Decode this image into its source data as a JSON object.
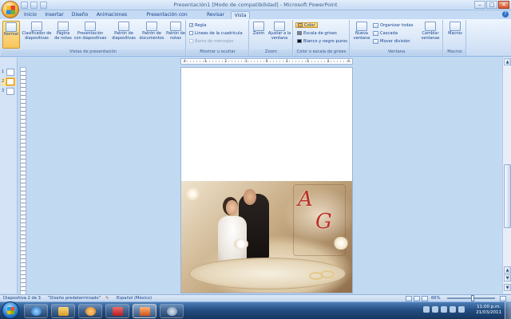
{
  "window": {
    "title": "Presentación1 [Modo de compatibilidad] - Microsoft PowerPoint",
    "controls": {
      "minimize": "–",
      "maximize": "□",
      "close": "✕"
    }
  },
  "ribbon_tabs": [
    "Inicio",
    "Insertar",
    "Diseño",
    "Animaciones",
    "Presentación con diapositivas",
    "Revisar",
    "Vista"
  ],
  "active_tab": "Vista",
  "groups": {
    "vistas": {
      "label": "Vistas de presentación",
      "buttons": [
        "Normal",
        "Clasificador de diapositivas",
        "Página de notas",
        "Presentación con diapositivas",
        "Patrón de diapositivas",
        "Patrón de documentos",
        "Patrón de notas"
      ]
    },
    "mostrar": {
      "label": "Mostrar u ocultar",
      "items": [
        {
          "label": "Regla",
          "checked": true
        },
        {
          "label": "Líneas de la cuadrícula",
          "checked": false
        },
        {
          "label": "Barra de mensajes",
          "checked": false,
          "disabled": true
        }
      ]
    },
    "zoom": {
      "label": "Zoom",
      "buttons": [
        "Zoom",
        "Ajustar a la ventana"
      ]
    },
    "color": {
      "label": "Color o escala de grises",
      "items": [
        {
          "label": "Color",
          "swatch": "#f4b03c",
          "selected": true
        },
        {
          "label": "Escala de grises",
          "swatch": "#808080"
        },
        {
          "label": "Blanco y negro puros",
          "swatch": "#111111"
        }
      ]
    },
    "ventana": {
      "label": "Ventana",
      "big_button": "Nueva ventana",
      "items": [
        "Organizar todas",
        "Cascada",
        "Mover división"
      ],
      "switch_button": "Cambiar ventanas"
    },
    "macros": {
      "label": "Macros",
      "button": "Macros"
    }
  },
  "thumbnails": [
    "1",
    "2",
    "3"
  ],
  "active_thumbnail": "2",
  "slide": {
    "monogram_1": "A",
    "monogram_2": "G"
  },
  "ruler_numbers": [
    "4",
    "3",
    "2",
    "1",
    "0",
    "1",
    "2",
    "3",
    "4"
  ],
  "statusbar": {
    "slide_info": "Diapositiva 2 de 3",
    "theme": "\"Diseño predeterminado\"",
    "language": "Español (México)",
    "zoom": "66%"
  },
  "taskbar": {
    "time": "11:00 p.m.",
    "date": "21/03/2011"
  },
  "colors": {
    "ribbon_blue": "#dbe8f8",
    "selected_orange": "#f8c45a",
    "workspace": "#c2d9f2",
    "taskbar": "#254f84"
  }
}
